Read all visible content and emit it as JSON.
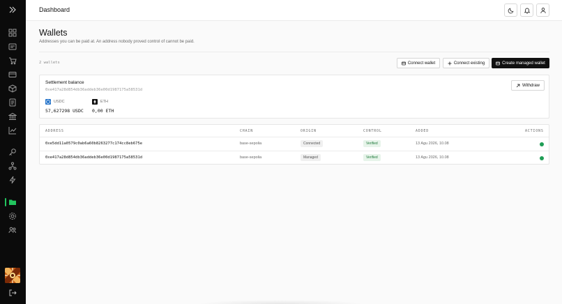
{
  "topbar": {
    "title": "Dashboard",
    "icons": [
      "moon-icon",
      "bell-icon",
      "user-icon"
    ]
  },
  "sidebar": {
    "icons": [
      "expand-icon",
      "grid-icon",
      "inbox-icon",
      "cart-icon",
      "card-icon",
      "box-icon",
      "document-icon",
      "bank-icon",
      "chart-icon",
      "key-icon",
      "network-icon",
      "bolt-icon",
      "folder-icon",
      "settings-icon",
      "users-icon",
      "logout-icon"
    ],
    "active_item": "folder-icon",
    "accent": "#22c55e"
  },
  "page": {
    "title": "Wallets",
    "subtitle": "Addresses you can be paid at. An address nobody proved control of cannot be paid.",
    "wallet_count": "2 wallets"
  },
  "actions": {
    "connect_wallet": "Connect wallet",
    "connect_existing": "Connect existing",
    "create_managed": "Create managed wallet"
  },
  "balance": {
    "label": "Settlement balance",
    "address": "0xe417a28d854db36addeb36e00d1987175a58531d",
    "withdraw": "Withdraw",
    "tokens": [
      {
        "symbol": "USDC",
        "amount": "57,627298 USDC",
        "icon": "usdc-icon"
      },
      {
        "symbol": "ETH",
        "amount": "0,00 ETH",
        "icon": "eth-icon"
      }
    ]
  },
  "table": {
    "columns": [
      "ADDRESS",
      "CHAIN",
      "ORIGIN",
      "CONTROL",
      "ADDED",
      "ACTIONS"
    ],
    "rows": [
      {
        "address": "0xe5dd11a0579c0ab6a60b8263277c174cc8eb675e",
        "chain": "base-sepolia",
        "origin": "Connected",
        "control": "Verified",
        "added": "13 Agu 2026, 10.08"
      },
      {
        "address": "0xe417a28d854db36addeb36e00d1987175a58531d",
        "chain": "base-sepolia",
        "origin": "Managed",
        "control": "Verified",
        "added": "13 Agu 2026, 10.08"
      }
    ]
  },
  "colors": {
    "sidebar_bg": "#0b0b0b",
    "primary_button": "#111111",
    "verified_bg": "#e7f4ea",
    "verified_text": "#1f7a3a",
    "status_dot": "#1f9d55"
  }
}
